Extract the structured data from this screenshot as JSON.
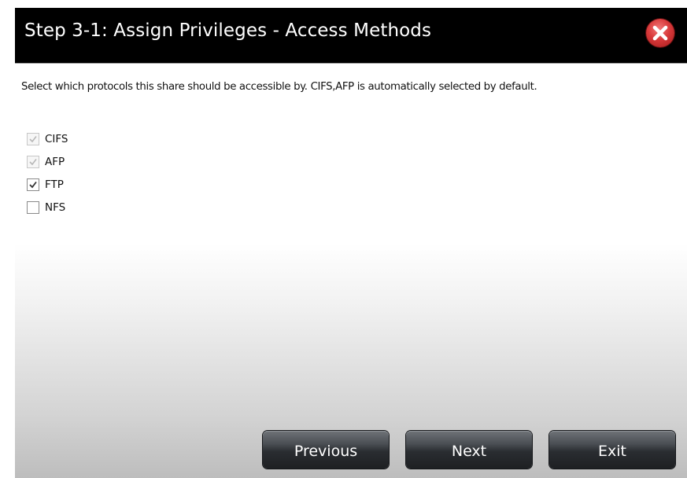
{
  "dialog": {
    "title": "Step 3-1: Assign Privileges - Access Methods",
    "close_icon": "close-x-circle-icon",
    "description": "Select which protocols this share should be accessible by. CIFS,AFP is automatically selected by default."
  },
  "protocols": [
    {
      "label": "CIFS",
      "checked": true,
      "disabled": true
    },
    {
      "label": "AFP",
      "checked": true,
      "disabled": true
    },
    {
      "label": "FTP",
      "checked": true,
      "disabled": false
    },
    {
      "label": "NFS",
      "checked": false,
      "disabled": false
    }
  ],
  "buttons": {
    "previous": "Previous",
    "next": "Next",
    "exit": "Exit"
  },
  "colors": {
    "titlebar": "#000000",
    "close_button": "#d8393a",
    "button": "#2a2d31",
    "check_disabled": "#b8b8b8",
    "check_enabled": "#333333"
  }
}
